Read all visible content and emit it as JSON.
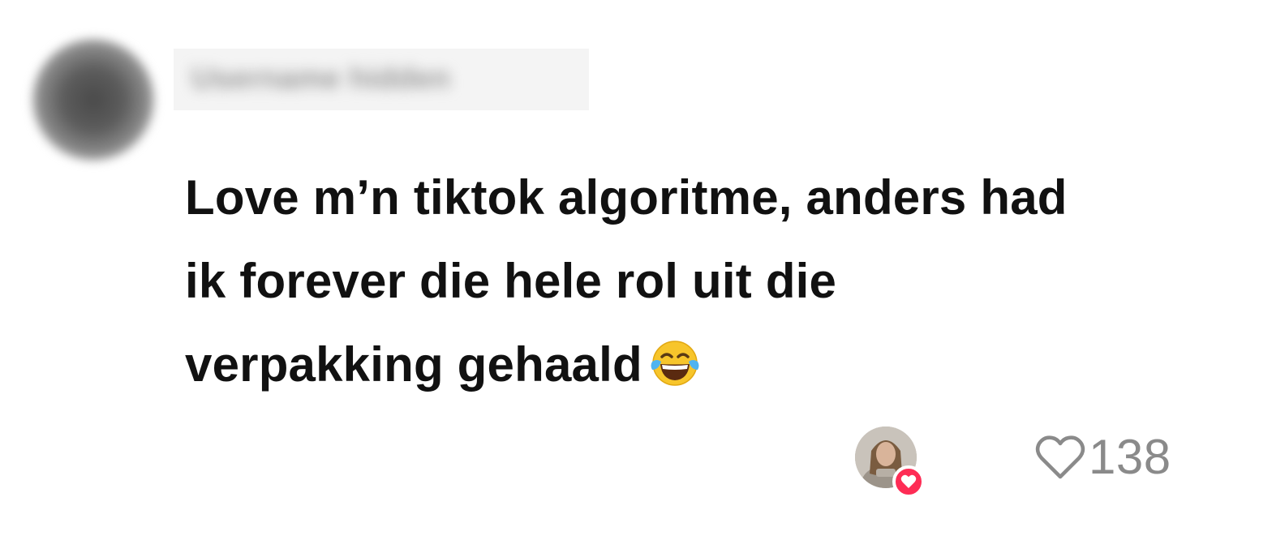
{
  "comment": {
    "username": "Username hidden",
    "text_lines": [
      "Love m’n tiktok algoritme, anders had",
      "ik forever die hele rol uit die",
      "verpakking gehaald"
    ],
    "emoji": "face-with-tears-of-joy",
    "creator_liked": true,
    "like_count": "138"
  },
  "icons": {
    "like": "heart-outline-icon",
    "creator_badge": "heart-badge-icon"
  },
  "colors": {
    "text": "#111111",
    "muted": "#8a8a8a",
    "accent": "#fe2c55",
    "emoji_yellow": "#f7c52b"
  }
}
